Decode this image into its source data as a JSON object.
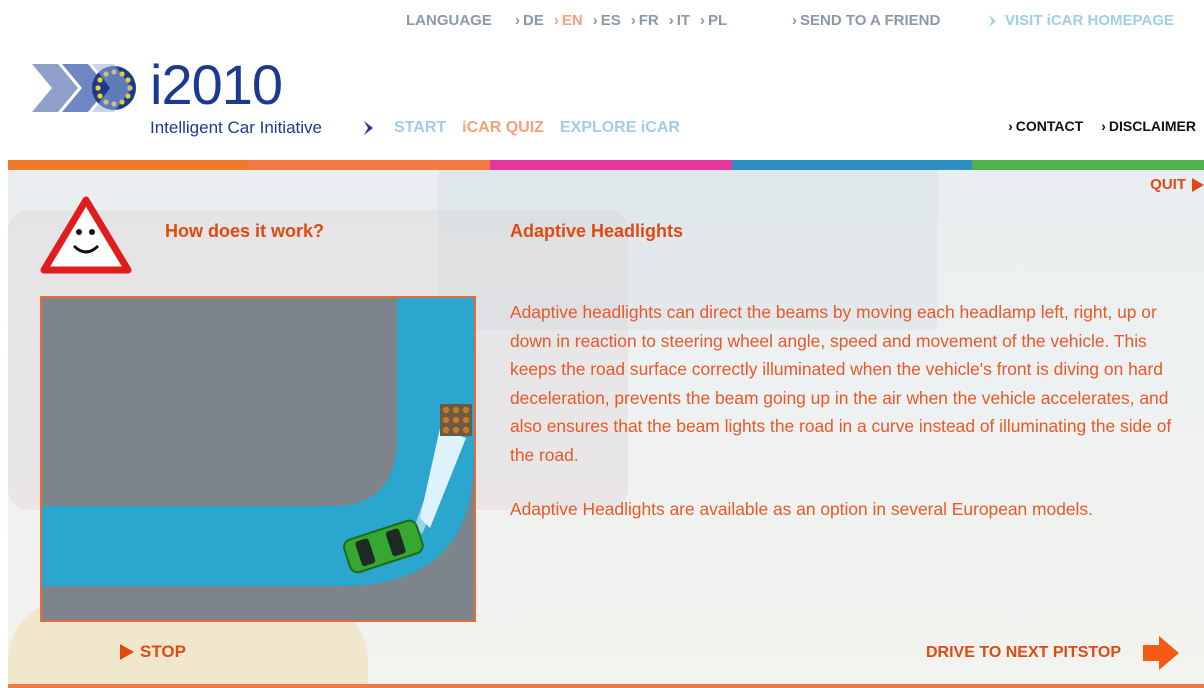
{
  "topbar": {
    "language_label": "LANGUAGE",
    "languages": [
      {
        "code": "DE",
        "active": false
      },
      {
        "code": "EN",
        "active": true
      },
      {
        "code": "ES",
        "active": false
      },
      {
        "code": "FR",
        "active": false
      },
      {
        "code": "IT",
        "active": false
      },
      {
        "code": "PL",
        "active": false
      }
    ],
    "send_to_friend": "SEND TO A FRIEND",
    "visit_homepage": "VISIT iCAR HOMEPAGE"
  },
  "logo": {
    "title": "i2010",
    "subtitle": "Intelligent Car Initiative"
  },
  "mainnav": {
    "start": "START",
    "quiz": "iCAR QUIZ",
    "explore": "EXPLORE iCAR"
  },
  "rightnav": {
    "contact": "CONTACT",
    "disclaimer": "DISCLAIMER"
  },
  "content": {
    "quit": "QUIT",
    "how_it_works": "How does it work?",
    "title": "Adaptive Headlights",
    "description": "Adaptive headlights can direct the beams by moving each headlamp left, right, up or down in reaction to steering wheel angle, speed and movement of the vehicle. This keeps the road surface correctly illuminated when the vehicle's front is diving on hard deceleration, prevents the beam going up in the air when the vehicle accelerates, and also ensures that the beam lights the road in a curve instead of illuminating the side of the road.",
    "availability": "Adaptive Headlights are available as an option in several European models.",
    "stop": "STOP",
    "next_pitstop": "DRIVE TO NEXT PITSTOP"
  },
  "colors": {
    "accent": "#e04a12",
    "stripe": [
      "#f07a2a",
      "#f07a2a",
      "#e5379b",
      "#2c8fc4",
      "#4fb24a"
    ]
  }
}
